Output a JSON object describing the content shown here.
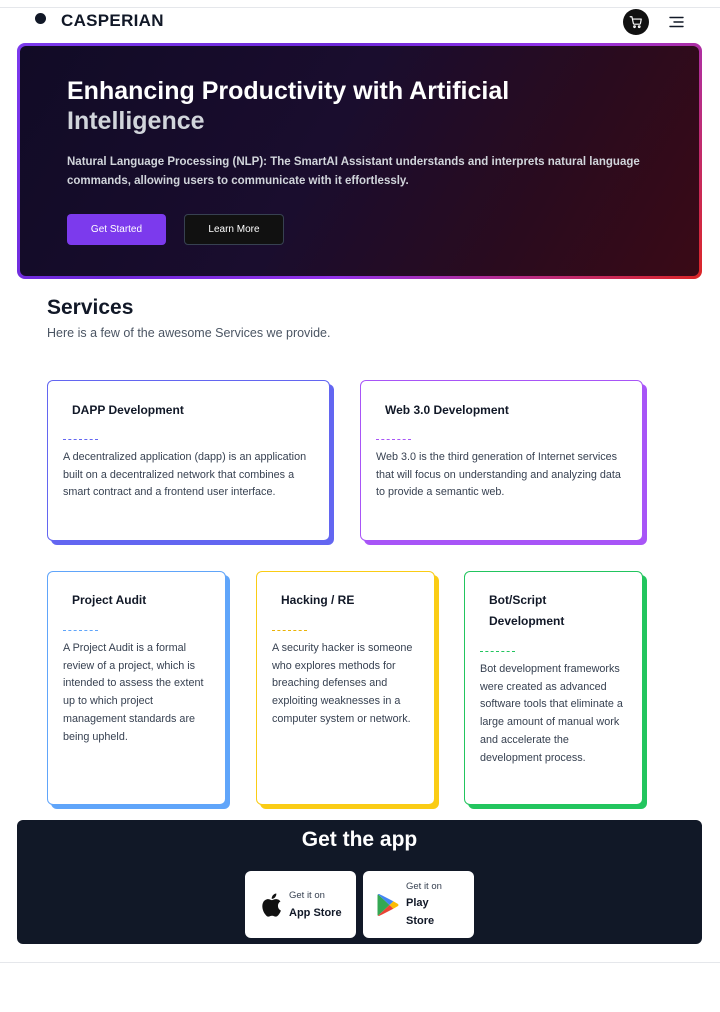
{
  "header": {
    "brand": "CASPERIAN",
    "cart_icon": "cart-icon",
    "menu_icon": "hamburger-menu-icon"
  },
  "hero": {
    "title_line1": "Enhancing Productivity with Artificial",
    "title_line2": "Intelligence",
    "description": "Natural Language Processing (NLP): The SmartAI Assistant understands and interprets natural language commands, allowing users to communicate with it effortlessly.",
    "primary_button": "Get Started",
    "secondary_button": "Learn More",
    "accent_color": "#7c3aed"
  },
  "services": {
    "title": "Services",
    "subtitle": "Here is a few of the awesome Services we provide.",
    "cards": [
      {
        "title": "DAPP Development",
        "text": "A decentralized application (dapp) is an application built on a decentralized network that combines a smart contract and a frontend user interface.",
        "color": "#6366f1"
      },
      {
        "title": "Web 3.0 Development",
        "text": "Web 3.0 is the third generation of Internet services that will focus on understanding and analyzing data to provide a semantic web.",
        "color": "#a855f7"
      },
      {
        "title": "Project Audit",
        "text": "A Project Audit is a formal review of a project, which is intended to assess the extent up to which project management standards are being upheld.",
        "color": "#60a5fa"
      },
      {
        "title": "Hacking / RE",
        "text": "A security hacker is someone who explores methods for breaching defenses and exploiting weaknesses in a computer system or network.",
        "color": "#facc15"
      },
      {
        "title": "Bot/Script Development",
        "text": "Bot development frameworks were created as advanced software tools that eliminate a large amount of manual work and accelerate the development process.",
        "color": "#22c55e"
      }
    ]
  },
  "app": {
    "title": "Get the app",
    "apple": {
      "small": "Get it on",
      "big": "App Store",
      "icon": "apple-icon"
    },
    "google": {
      "small": "Get it on",
      "big": "Play Store",
      "icon": "google-play-icon"
    }
  }
}
